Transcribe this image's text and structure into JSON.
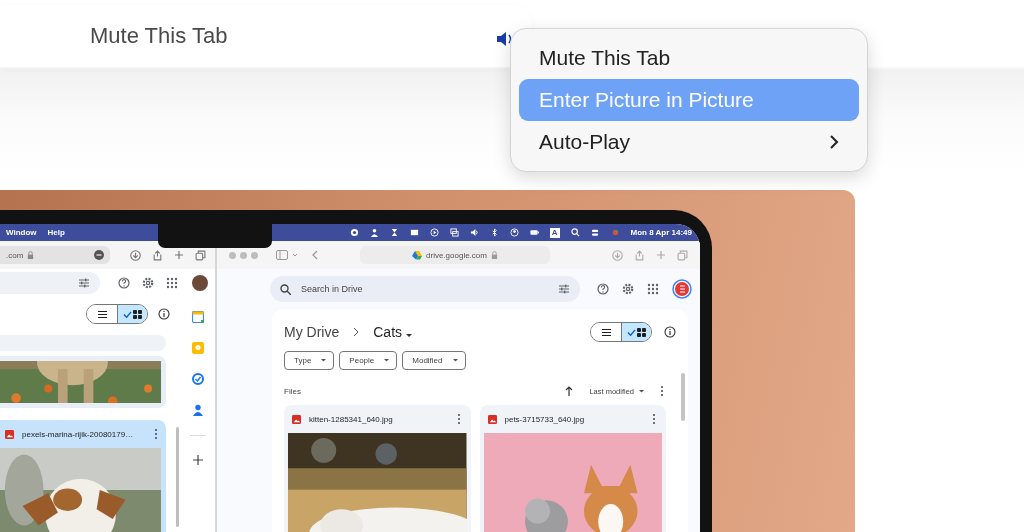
{
  "tab": {
    "title": "Mute This Tab"
  },
  "context_menu": {
    "items": [
      {
        "label": "Mute This Tab",
        "selected": false,
        "submenu": false
      },
      {
        "label": "Enter Picture in Picture",
        "selected": true,
        "submenu": false
      },
      {
        "label": "Auto-Play",
        "selected": false,
        "submenu": true
      }
    ]
  },
  "laptop": {
    "menu_bar": {
      "menus": [
        "Window",
        "Help"
      ],
      "input_source": "A",
      "clock": "Mon 8 Apr 14:49"
    },
    "left_window": {
      "url": ".com",
      "view_toggle": [
        {
          "kind": "list",
          "selected": false
        },
        {
          "kind": "grid",
          "selected": true
        }
      ],
      "file_card": {
        "name": "pexels-marina-rijik-20080179…",
        "selected": true
      }
    },
    "right_window": {
      "url": "drive.google.com",
      "search": {
        "placeholder": "Search in Drive"
      },
      "breadcrumb": [
        "My Drive",
        "Cats"
      ],
      "view_toggle": [
        {
          "kind": "list",
          "selected": false
        },
        {
          "kind": "grid",
          "selected": true
        }
      ],
      "filters": [
        "Type",
        "People",
        "Modified"
      ],
      "section": "Files",
      "sort": "Last modified",
      "files": [
        {
          "name": "kitten-1285341_640.jpg"
        },
        {
          "name": "pets-3715733_640.jpg"
        }
      ]
    }
  }
}
